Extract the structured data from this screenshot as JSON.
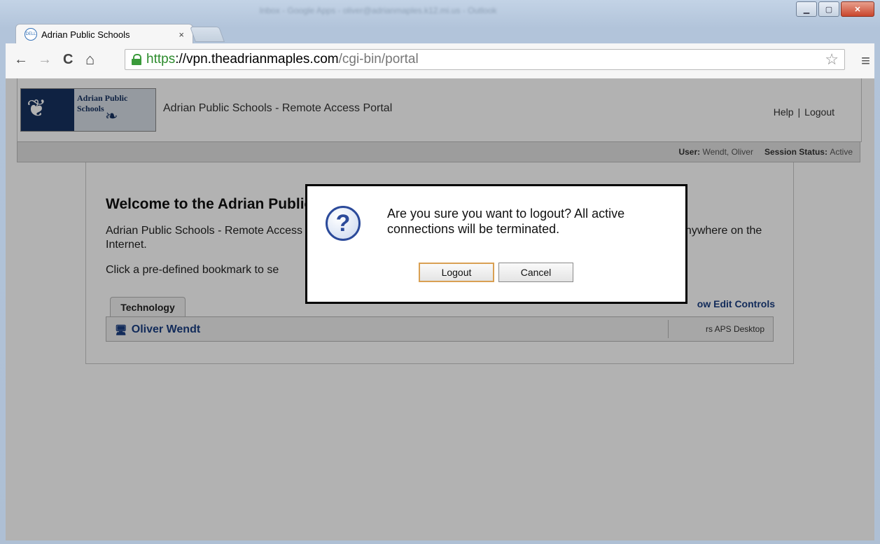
{
  "window": {
    "title": "Inbox - Google Apps - oliver@adrianmaples.k12.mi.us - Outlook",
    "controls": {
      "minimize": "▁",
      "maximize": "▢",
      "close": "✕"
    }
  },
  "browser": {
    "tab_title": "Adrian Public Schools",
    "tab_favicon": "DELL",
    "tab_close": "×",
    "url_scheme": "https",
    "url_host": "://vpn.theadrianmaples.com",
    "url_path": "/cgi-bin/portal"
  },
  "header": {
    "logo_text": "Adrian Public Schools",
    "portal_title": "Adrian Public Schools - Remote Access Portal",
    "help": "Help",
    "separator": "|",
    "logout": "Logout"
  },
  "status": {
    "user_label": "User:",
    "user_value": "Wendt, Oliver",
    "session_label": "Session Status:",
    "session_value": "Active"
  },
  "main": {
    "welcome": "Welcome to the Adrian Public Schools - Remote Access Portal",
    "intro": "Adrian Public Schools - Remote Access Portal provides easy and secure remote access to the district network from anywhere on the Internet.",
    "click_text": "Click a pre-defined bookmark to se",
    "tab": "Technology",
    "edit_controls": "ow Edit Controls",
    "bookmark_name": "Oliver Wendt",
    "bookmark_desc": "rs APS Desktop"
  },
  "dialog": {
    "message": "Are you sure you want to logout? All active connections will be terminated.",
    "ok_label": "Logout",
    "cancel_label": "Cancel"
  },
  "colors": {
    "accent": "#1a3e82",
    "secure_green": "#2c8b2c",
    "dialog_focus": "#d9a053"
  }
}
